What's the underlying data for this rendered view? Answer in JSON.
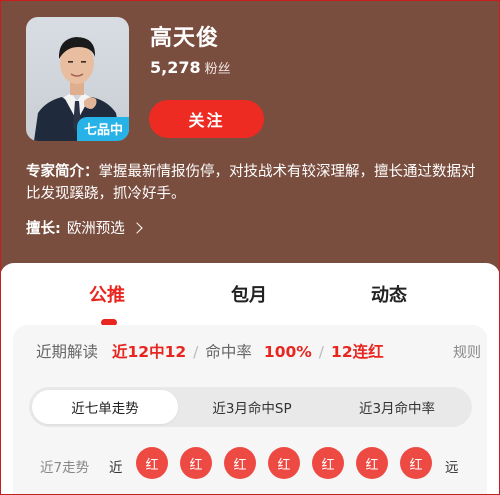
{
  "profile": {
    "name": "高天俊",
    "fans_count": "5,278",
    "fans_label": "粉丝",
    "level_badge": "七品中",
    "follow_label": "关注"
  },
  "intro": {
    "label": "专家简介：",
    "text": "掌握最新情报伤停，对技战术有较深理解，擅长通过数据对比发现蹊跷，抓冷好手。"
  },
  "specialty": {
    "label": "擅长:",
    "value": "欧洲预选"
  },
  "tabs": [
    {
      "label": "公推",
      "active": true
    },
    {
      "label": "包月",
      "active": false
    },
    {
      "label": "动态",
      "active": false
    }
  ],
  "stats": {
    "recent_label": "近期解读",
    "recent_value": "近12中12",
    "sep1": "/",
    "hit_label": "命中率",
    "hit_value": "100%",
    "sep2": "/",
    "streak_value": "12连红",
    "rules_label": "规则"
  },
  "segments": [
    {
      "label": "近七单走势",
      "active": true
    },
    {
      "label": "近3月命中SP",
      "active": false
    },
    {
      "label": "近3月命中率",
      "active": false
    }
  ],
  "trend": {
    "label": "近7走势",
    "near": "近",
    "far": "远",
    "results": [
      "红",
      "红",
      "红",
      "红",
      "红",
      "红",
      "红"
    ]
  },
  "colors": {
    "header_bg": "#7a4e3f",
    "accent_red": "#e8261f",
    "badge_blue": "#27b3e8"
  }
}
